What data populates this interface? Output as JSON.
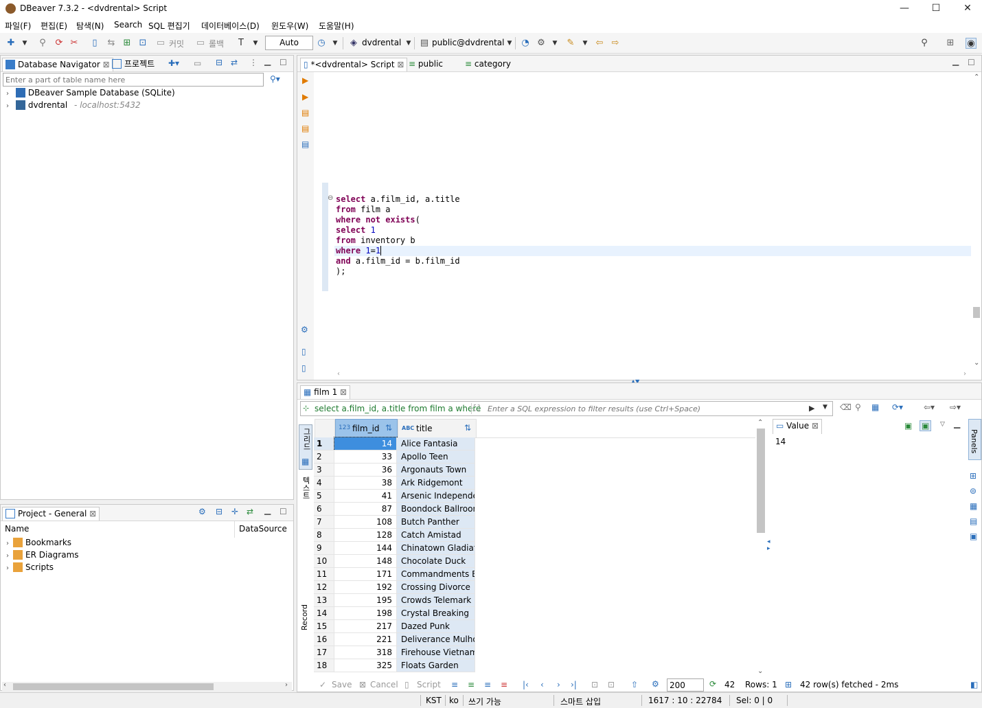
{
  "window": {
    "title": "DBeaver 7.3.2 - <dvdrental> Script",
    "minimize": "—",
    "maximize": "☐",
    "close": "✕"
  },
  "menu": [
    "파일(F)",
    "편집(E)",
    "탐색(N)",
    "Search",
    "SQL 편집기",
    "데이터베이스(D)",
    "윈도우(W)",
    "도움말(H)"
  ],
  "toolbar": {
    "commit_label": "커밋",
    "rollback_label": "롤백",
    "transaction_mode": "Auto",
    "datasource": "dvdrental",
    "schema": "public@dvdrental"
  },
  "navigator": {
    "tab_label": "Database Navigator",
    "project_tab_label": "프로젝트",
    "filter_placeholder": "Enter a part of table name here",
    "items": [
      {
        "label": "DBeaver Sample Database (SQLite)",
        "detail": ""
      },
      {
        "label": "dvdrental",
        "detail": "- localhost:5432"
      }
    ]
  },
  "project": {
    "tab_label": "Project - General",
    "col_name": "Name",
    "col_datasource": "DataSource",
    "items": [
      "Bookmarks",
      "ER Diagrams",
      "Scripts"
    ]
  },
  "editor_tabs": [
    "*<dvdrental> Script",
    "public",
    "category"
  ],
  "sql": [
    [
      {
        "t": "select",
        "k": "kw"
      },
      {
        "t": " a.film_id, a.title",
        "k": ""
      }
    ],
    [
      {
        "t": "from",
        "k": "kw"
      },
      {
        "t": " film a",
        "k": ""
      }
    ],
    [
      {
        "t": "where not exists",
        "k": "kw"
      },
      {
        "t": "(",
        "k": ""
      }
    ],
    [
      {
        "t": "select",
        "k": "kw"
      },
      {
        "t": " ",
        "k": ""
      },
      {
        "t": "1",
        "k": "num"
      }
    ],
    [
      {
        "t": "from",
        "k": "kw"
      },
      {
        "t": " inventory b",
        "k": ""
      }
    ],
    [
      {
        "t": "where",
        "k": "kw"
      },
      {
        "t": " ",
        "k": ""
      },
      {
        "t": "1",
        "k": "num"
      },
      {
        "t": "=",
        "k": ""
      },
      {
        "t": "1",
        "k": "num"
      }
    ],
    [
      {
        "t": "and",
        "k": "kw"
      },
      {
        "t": " a.film_id = b.film_id",
        "k": ""
      }
    ],
    [
      {
        "t": ");",
        "k": ""
      }
    ]
  ],
  "results": {
    "tab_label": "film 1",
    "query_preview": "select a.film_id, a.title from film a where",
    "filter_placeholder": "Enter a SQL expression to filter results (use Ctrl+Space)",
    "side_tabs": [
      "그리드",
      "텍스트",
      "Record"
    ],
    "columns": [
      {
        "type": "123",
        "name": "film_id"
      },
      {
        "type": "ABC",
        "name": "title"
      }
    ],
    "rows": [
      [
        "1",
        "14",
        "Alice Fantasia"
      ],
      [
        "2",
        "33",
        "Apollo Teen"
      ],
      [
        "3",
        "36",
        "Argonauts Town"
      ],
      [
        "4",
        "38",
        "Ark Ridgemont"
      ],
      [
        "5",
        "41",
        "Arsenic Independence"
      ],
      [
        "6",
        "87",
        "Boondock Ballroom"
      ],
      [
        "7",
        "108",
        "Butch Panther"
      ],
      [
        "8",
        "128",
        "Catch Amistad"
      ],
      [
        "9",
        "144",
        "Chinatown Gladiator"
      ],
      [
        "10",
        "148",
        "Chocolate Duck"
      ],
      [
        "11",
        "171",
        "Commandments Express"
      ],
      [
        "12",
        "192",
        "Crossing Divorce"
      ],
      [
        "13",
        "195",
        "Crowds Telemark"
      ],
      [
        "14",
        "198",
        "Crystal Breaking"
      ],
      [
        "15",
        "217",
        "Dazed Punk"
      ],
      [
        "16",
        "221",
        "Deliverance Mulholland"
      ],
      [
        "17",
        "318",
        "Firehouse Vietnam"
      ],
      [
        "18",
        "325",
        "Floats Garden"
      ]
    ],
    "value_panel_label": "Value",
    "value_panel_content": "14",
    "panels_label": "Panels",
    "footer": {
      "save": "Save",
      "cancel": "Cancel",
      "script": "Script",
      "fetch_size": "200",
      "count": "42",
      "rows_label": "Rows: 1",
      "fetched": "42 row(s) fetched - 2ms"
    }
  },
  "status": {
    "timezone": "KST",
    "locale": "ko",
    "mode": "쓰기 가능",
    "insert_mode": "스마트 삽입",
    "position": "1617 : 10 : 22784",
    "selection": "Sel: 0 | 0"
  },
  "colors": {
    "keyword": "#7f0055",
    "number": "#0000c0",
    "selection_blue": "#3e8ede",
    "accent": "#2a6ebb"
  }
}
